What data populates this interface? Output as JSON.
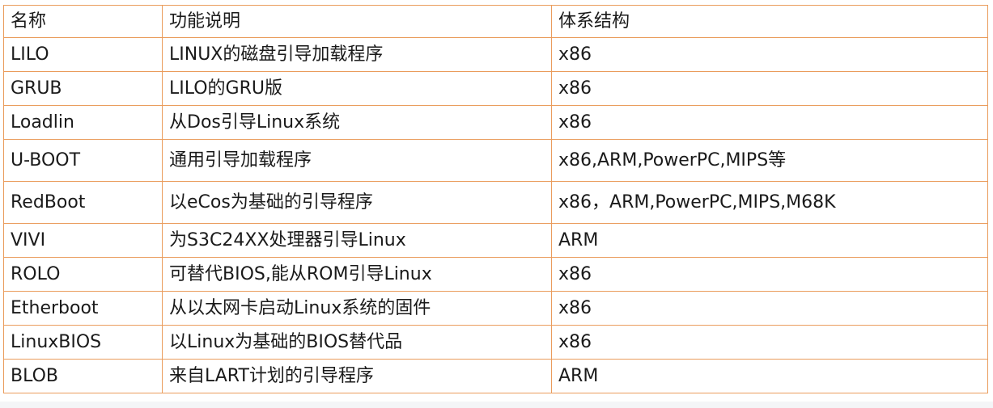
{
  "table": {
    "header": [
      "名称",
      "功能说明",
      "体系结构"
    ],
    "rows": [
      [
        "LILO",
        "LINUX的磁盘引导加载程序",
        "x86"
      ],
      [
        "GRUB",
        "LILO的GRU版",
        "x86"
      ],
      [
        "Loadlin",
        "从Dos引导Linux系统",
        "x86"
      ],
      [
        "U-BOOT",
        "通用引导加载程序",
        "x86,ARM,PowerPC,MIPS等"
      ],
      [
        "RedBoot",
        "以eCos为基础的引导程序",
        "x86，ARM,PowerPC,MIPS,M68K"
      ],
      [
        "VIVI",
        "为S3C24XX处理器引导Linux",
        "ARM"
      ],
      [
        "ROLO",
        "可替代BIOS,能从ROM引导Linux",
        "x86"
      ],
      [
        "Etherboot",
        "从以太网卡启动Linux系统的固件",
        "x86"
      ],
      [
        "LinuxBIOS",
        "以Linux为基础的BIOS替代品",
        "x86"
      ],
      [
        "BLOB",
        "来自LART计划的引导程序",
        "ARM"
      ]
    ]
  },
  "colors": {
    "border": "#ea9c5c",
    "text": "#1a1a1a",
    "background": "#ffffff"
  }
}
